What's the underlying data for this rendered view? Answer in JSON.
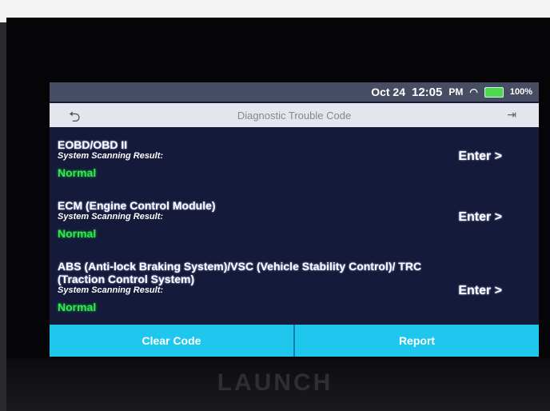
{
  "status_bar": {
    "date": "Oct 24",
    "time": "12:05",
    "ampm": "PM",
    "battery": "100%"
  },
  "title_bar": {
    "title": "Diagnostic Trouble Code"
  },
  "systems": [
    {
      "name": "EOBD/OBD II",
      "subtitle": "System Scanning Result:",
      "status": "Normal",
      "enter_label": "Enter >"
    },
    {
      "name": "ECM (Engine Control Module)",
      "subtitle": "System Scanning Result:",
      "status": "Normal",
      "enter_label": "Enter >"
    },
    {
      "name": "ABS (Anti-lock Braking System)/VSC (Vehicle Stability Control)/ TRC (Traction Control System)",
      "subtitle": "System Scanning Result:",
      "status": "Normal",
      "enter_label": "Enter >"
    }
  ],
  "bottom_bar": {
    "clear_code": "Clear Code",
    "report": "Report"
  },
  "device": {
    "brand": "LAUNCH"
  },
  "colors": {
    "screen_bg": "#15193a",
    "status_normal": "#2eea4d",
    "button_bar": "#1fc6ee"
  }
}
